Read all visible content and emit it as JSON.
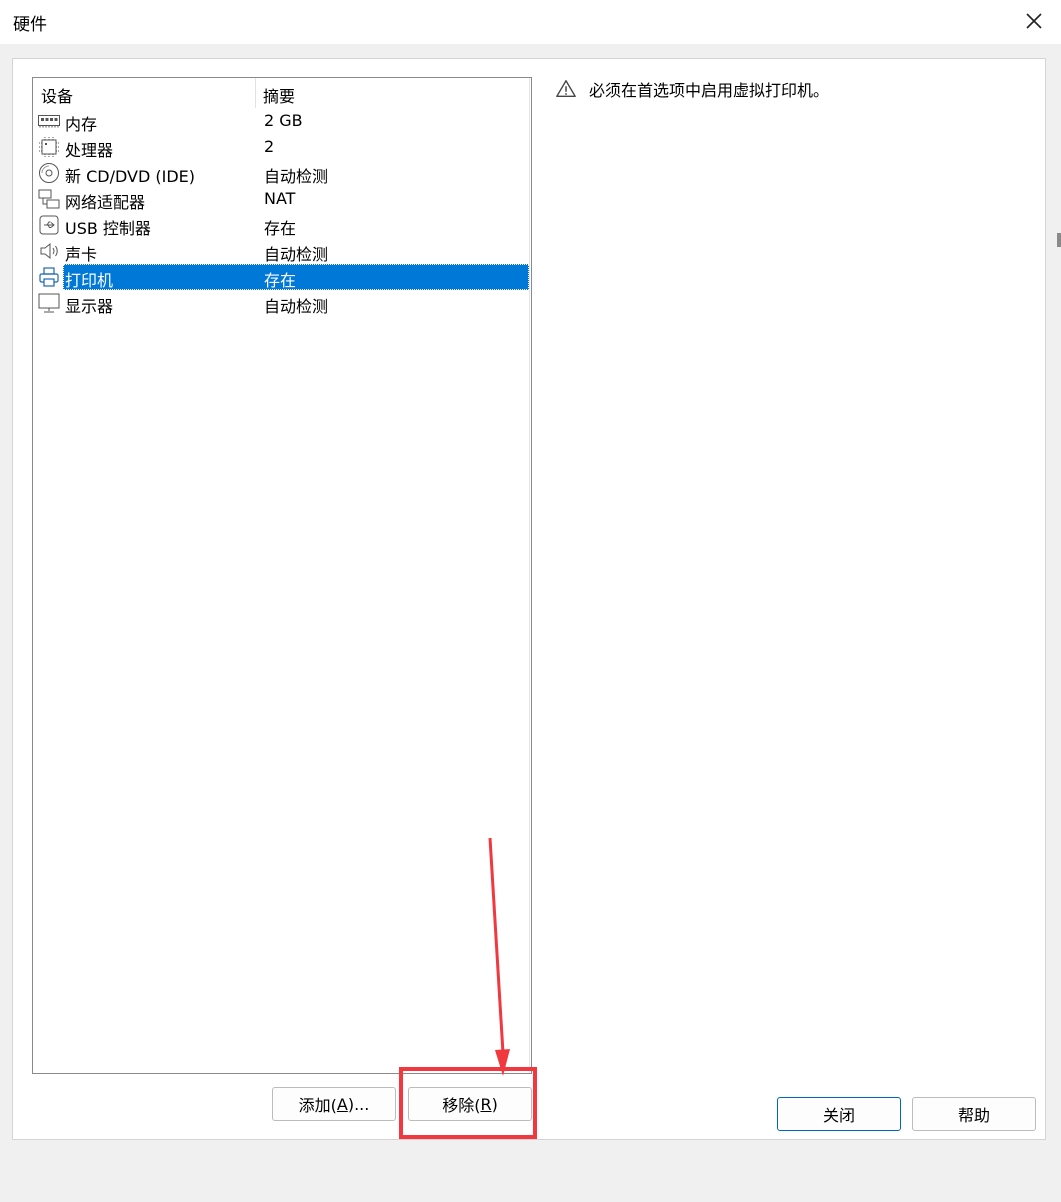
{
  "window": {
    "title": "硬件"
  },
  "list": {
    "headers": {
      "device": "设备",
      "summary": "摘要"
    },
    "rows": [
      {
        "icon": "memory-icon",
        "name": "内存",
        "value": "2 GB"
      },
      {
        "icon": "processor-icon",
        "name": "处理器",
        "value": "2"
      },
      {
        "icon": "cd-dvd-icon",
        "name": "新 CD/DVD (IDE)",
        "value": "自动检测"
      },
      {
        "icon": "network-adapter-icon",
        "name": "网络适配器",
        "value": "NAT"
      },
      {
        "icon": "usb-icon",
        "name": "USB 控制器",
        "value": "存在"
      },
      {
        "icon": "speaker-icon",
        "name": "声卡",
        "value": "自动检测"
      },
      {
        "icon": "printer-icon",
        "name": "打印机",
        "value": "存在",
        "selected": true
      },
      {
        "icon": "display-icon",
        "name": "显示器",
        "value": "自动检测"
      }
    ]
  },
  "warning": {
    "icon": "warning-icon",
    "text": "必须在首选项中启用虚拟打印机。"
  },
  "buttons": {
    "add": {
      "prefix": "添加(",
      "mnemonic": "A",
      "suffix": ")..."
    },
    "remove": {
      "prefix": "移除(",
      "mnemonic": "R",
      "suffix": ")"
    },
    "close": "关闭",
    "help": "帮助"
  },
  "annotation": {
    "color": "#f2383f"
  },
  "colors": {
    "selection": "#0078d7",
    "default_button_border": "#0067c0"
  }
}
